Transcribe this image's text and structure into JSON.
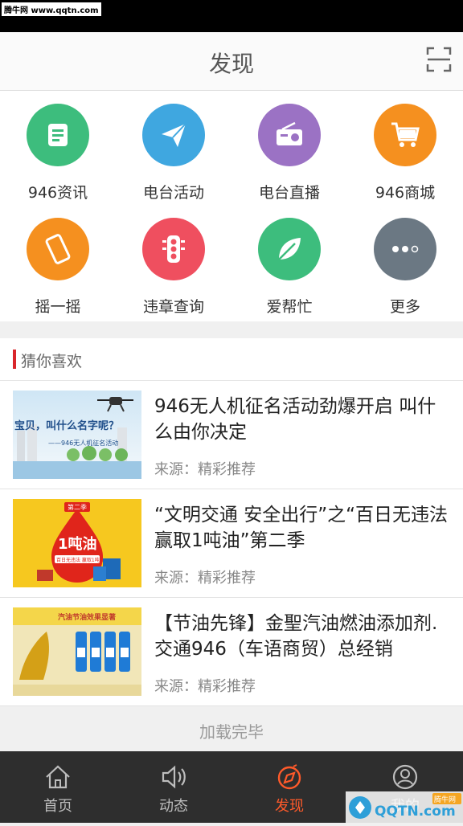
{
  "watermark": "腾牛网 www.qqtn.com",
  "header": {
    "title": "发现"
  },
  "grid": [
    {
      "label": "946资讯",
      "icon": "news-doc-icon",
      "color": "#3dbd7d"
    },
    {
      "label": "电台活动",
      "icon": "paper-plane-icon",
      "color": "#3fa7e0"
    },
    {
      "label": "电台直播",
      "icon": "radio-icon",
      "color": "#9b72c4"
    },
    {
      "label": "946商城",
      "icon": "shopping-cart-icon",
      "color": "#f5901f"
    },
    {
      "label": "摇一摇",
      "icon": "phone-shake-icon",
      "color": "#f5901f"
    },
    {
      "label": "违章查询",
      "icon": "traffic-light-icon",
      "color": "#ef4f5f"
    },
    {
      "label": "爱帮忙",
      "icon": "leaf-icon",
      "color": "#3dbd7d"
    },
    {
      "label": "更多",
      "icon": "more-dots-icon",
      "color": "#6b7883"
    }
  ],
  "recommend": {
    "title": "猜你喜欢",
    "items": [
      {
        "headline": "946无人机征名活动劲爆开启 叫什么由你决定",
        "source": "来源：精彩推荐",
        "thumb_text1": "宝贝，叫什么名字呢？",
        "thumb_text2": "——946无人机征名活动"
      },
      {
        "headline": "“文明交通 安全出行”之“百日无违法 赢取1吨油”第二季",
        "source": "来源：精彩推荐",
        "thumb_text1": "第二季",
        "thumb_text2": "1吨油",
        "thumb_text3": "百日无违法 赢取1吨油"
      },
      {
        "headline": "【节油先锋】金聖汽油燃油添加剂.交通946（车语商贸）总经销",
        "source": "来源：精彩推荐",
        "thumb_text1": "汽油节油效果显著"
      }
    ]
  },
  "loaded_text": "加载完毕",
  "tabs": [
    {
      "label": "首页",
      "icon": "home-icon"
    },
    {
      "label": "动态",
      "icon": "speaker-icon"
    },
    {
      "label": "发现",
      "icon": "discover-icon",
      "active": true
    },
    {
      "label": "我的",
      "icon": "user-icon"
    }
  ],
  "corner_logo": {
    "text": "QQTN.com",
    "badge": "腾牛网"
  },
  "colors": {
    "accent": "#ff5a2a",
    "tabbar": "#2e2e2e",
    "red_bar": "#d9262b"
  }
}
